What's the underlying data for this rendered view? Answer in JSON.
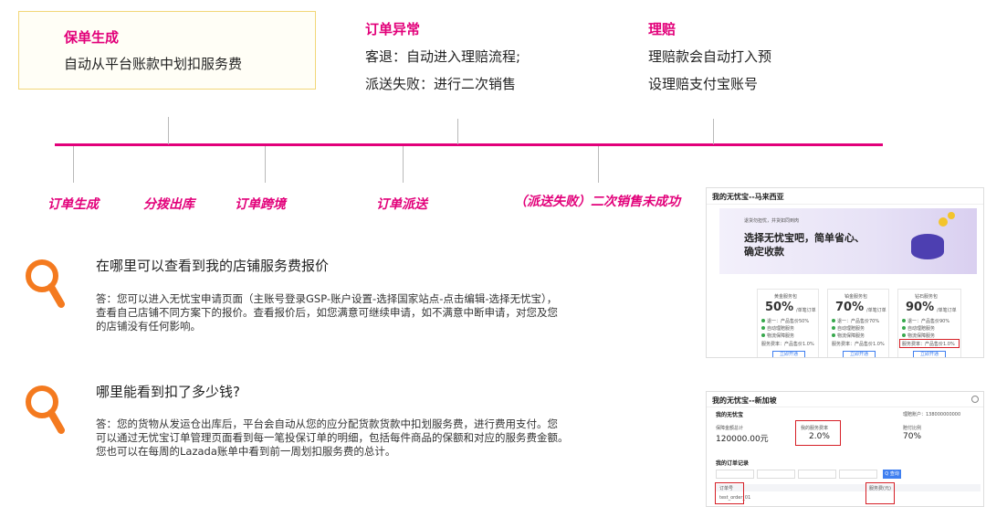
{
  "stages": {
    "s1": {
      "title": "保单生成",
      "text": "自动从平台账款中划扣服务费"
    },
    "s2": {
      "title": "订单异常",
      "line1": "客退：自动进入理赔流程;",
      "line2": "派送失败：进行二次销售"
    },
    "s3": {
      "title": "理赔",
      "line1": "理赔款会自动打入预",
      "line2": "设理赔支付宝账号"
    }
  },
  "milestones": [
    "订单生成",
    "分拨出库",
    "订单跨境",
    "订单派送",
    "（派送失败）二次销售未成功"
  ],
  "faq": [
    {
      "question": "在哪里可以查看到我的店铺服务费报价",
      "answer": [
        "答：您可以进入无忧宝申请页面（主账号登录GSP-账户设置-选择国家站点-点击编辑-选择无忧宝），",
        "查看自己店铺不同方案下的报价。查看报价后，如您满意可继续申请，如不满意中断申请，对您及您",
        "的店铺没有任何影响。"
      ]
    },
    {
      "question": "哪里能看到扣了多少钱?",
      "answer": [
        "答：您的货物从发运仓出库后，平台会自动从您的应分配货款货款中扣划服务费，进行费用支付。您",
        "可以通过无忧宝订单管理页面看到每一笔投保订单的明细，包括每件商品的保额和对应的服务费金额。",
        "您也可以在每周的Lazada账单中看到前一周划扣服务费的总计。"
      ]
    }
  ],
  "shot1": {
    "header": "我的无忧宝--马来西亚",
    "banner_small": "退货勿担忧，井货如同到肉",
    "banner_line1": "选择无忧宝吧，简单省心、",
    "banner_line2": "确定收款",
    "plans": [
      {
        "name": "黄金服务包",
        "pct": "50%",
        "unit": "/单笔订单",
        "f1": "退一：产品售价50%",
        "f2": "自动理赔服务",
        "f3": "物流保障服务",
        "btn": "立即开通"
      },
      {
        "name": "铂金服务包",
        "pct": "70%",
        "unit": "/单笔订单",
        "f1": "退一：产品售价70%",
        "f2": "自动理赔服务",
        "f3": "物流保障服务",
        "btn": "立即开通"
      },
      {
        "name": "钻石服务包",
        "pct": "90%",
        "unit": "/单笔订单",
        "f1": "退一：产品售价90%",
        "f2": "自动理赔服务",
        "f3": "物流保障服务",
        "btn": "立即开通"
      }
    ],
    "fee_line": "服务费率：产品售价1.0%"
  },
  "shot2": {
    "header": "我的无忧宝--新加坡",
    "section": "我的无忧宝",
    "account_label": "理赔账户：138000000000",
    "amount_label": "保障金额总计",
    "amount": "120000.00元",
    "rate_label": "我的服务费率",
    "rate": "2.0%",
    "ratio_label": "赔付比例",
    "ratio": "70%",
    "orders_title": "我的订单记录",
    "search_btn": "Q 查询",
    "col1": "订单号",
    "col5": "服务费(元)",
    "row_id": "test_order_01"
  },
  "colors": {
    "accent": "#e2007a",
    "icon": "#f47a1f",
    "highlight": "#d61f26"
  },
  "icons": {
    "question": "magnifier-icon"
  }
}
